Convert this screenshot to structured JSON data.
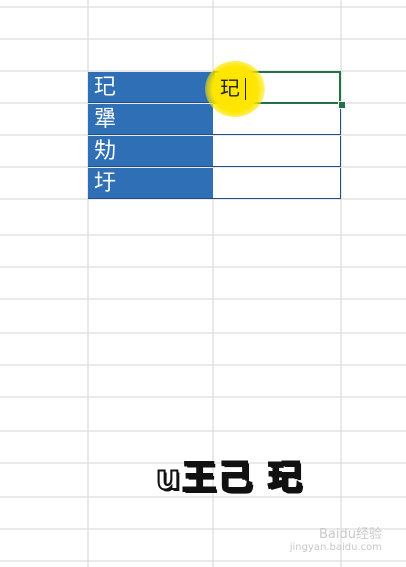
{
  "sheet": {
    "rows": [
      {
        "label": "玘",
        "value": ""
      },
      {
        "label": "犟",
        "value": ""
      },
      {
        "label": "劮",
        "value": ""
      },
      {
        "label": "圩",
        "value": ""
      }
    ],
    "editing_value": "玘"
  },
  "overlay_caption": "u王己 玘",
  "watermark": {
    "brand": "Baidu经验",
    "url": "jingyan.baidu.com"
  },
  "colors": {
    "cell_fill": "#2f6fb5",
    "highlight": "#ffe600",
    "selection": "#217346"
  }
}
